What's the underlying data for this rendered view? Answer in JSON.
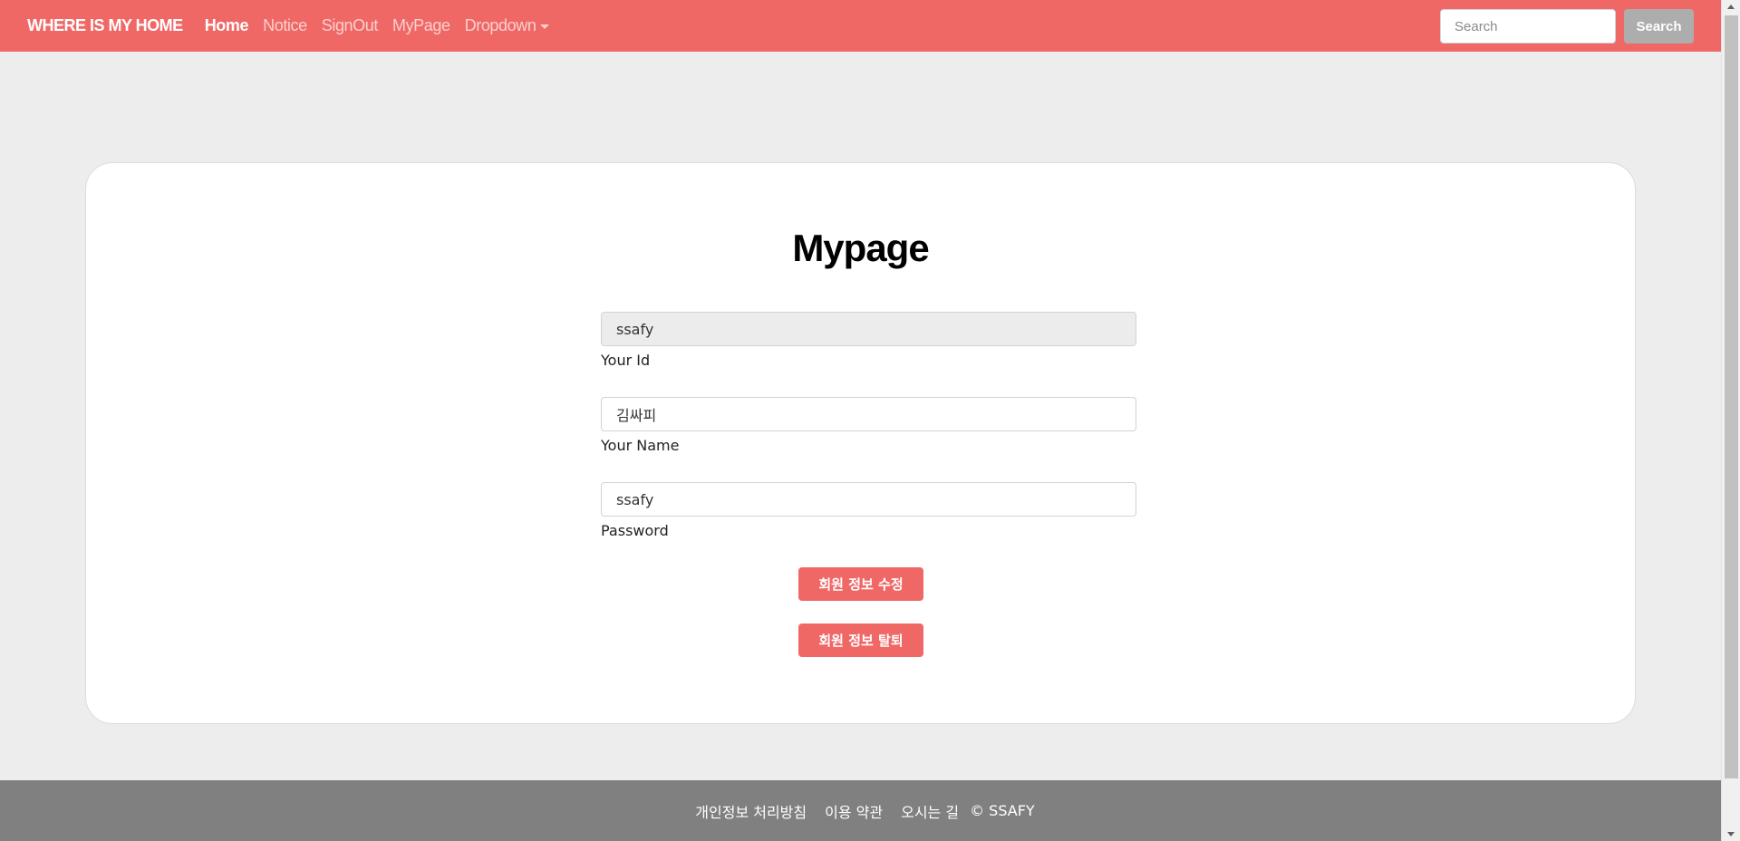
{
  "navbar": {
    "brand": "WHERE IS MY HOME",
    "links": [
      {
        "label": "Home",
        "active": true
      },
      {
        "label": "Notice",
        "active": false
      },
      {
        "label": "SignOut",
        "active": false
      },
      {
        "label": "MyPage",
        "active": false
      },
      {
        "label": "Dropdown",
        "active": false
      }
    ],
    "search": {
      "placeholder": "Search",
      "button_label": "Search"
    }
  },
  "main": {
    "title": "Mypage",
    "fields": {
      "id": {
        "value": "ssafy",
        "label": "Your Id"
      },
      "name": {
        "value": "김싸피",
        "label": "Your Name"
      },
      "password": {
        "value": "ssafy",
        "label": "Password"
      }
    },
    "buttons": {
      "update": "회원 정보 수정",
      "withdraw": "회원 정보 탈퇴"
    }
  },
  "footer": {
    "links": [
      "개인정보 처리방침",
      "이용 약관",
      "오시는 길"
    ],
    "copyright": "© SSAFY"
  },
  "colors": {
    "accent": "#ef6866",
    "footer_bg": "#808080",
    "page_bg": "#ededed"
  }
}
